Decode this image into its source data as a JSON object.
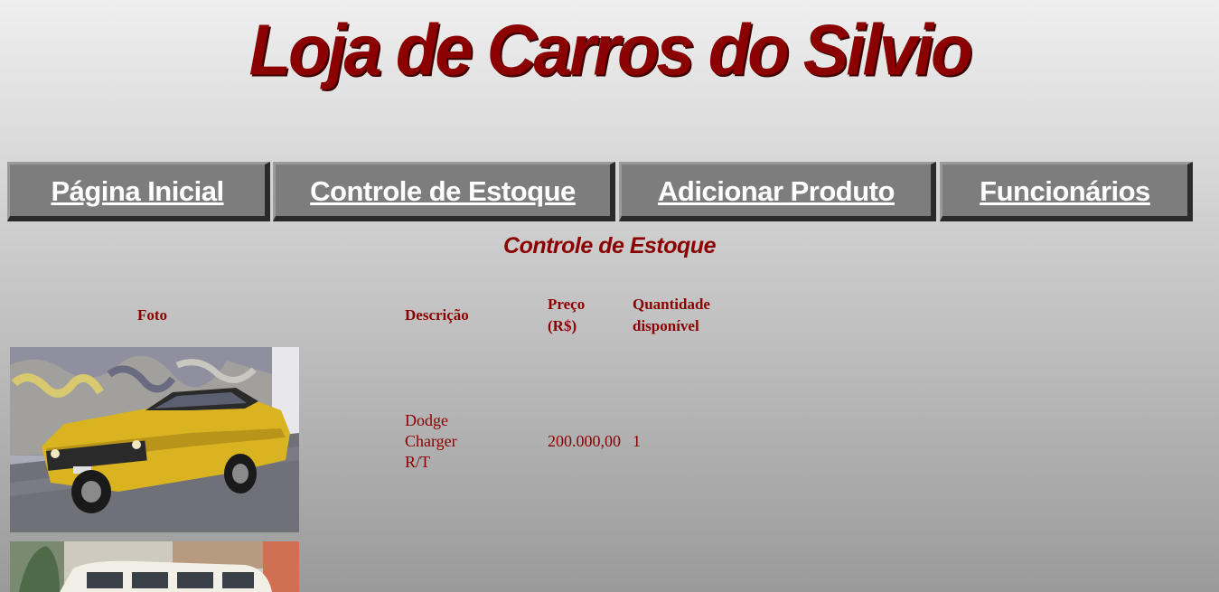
{
  "site": {
    "title": "Loja de Carros do Silvio"
  },
  "nav": {
    "items": [
      {
        "label": "Página Inicial"
      },
      {
        "label": "Controle de Estoque"
      },
      {
        "label": "Adicionar Produto"
      },
      {
        "label": "Funcionários"
      }
    ]
  },
  "page": {
    "section_title": "Controle de Estoque"
  },
  "table": {
    "headers": {
      "photo": "Foto",
      "description": "Descrição",
      "price_line1": "Preço",
      "price_line2": "(R$)",
      "qty_line1": "Quantidade",
      "qty_line2": "disponível"
    },
    "rows": [
      {
        "description_lines": [
          "Dodge",
          "Charger",
          "R/T"
        ],
        "price": "200.000,00",
        "quantity": "1"
      }
    ]
  },
  "colors": {
    "accent": "#8b0000",
    "nav_bg": "#7d7d7d",
    "nav_shadow": "#2a2a2a"
  }
}
